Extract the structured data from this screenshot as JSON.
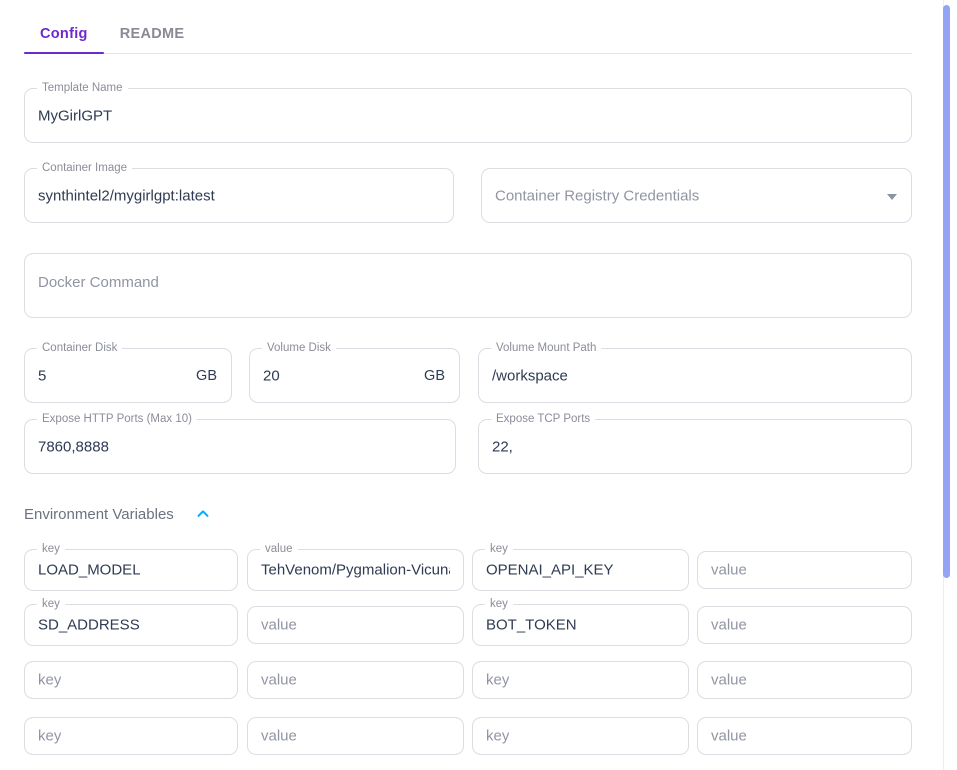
{
  "tabs": [
    {
      "label": "Config",
      "active": true
    },
    {
      "label": "README",
      "active": false
    }
  ],
  "colors": {
    "accent_purple": "#6b29cf",
    "chevron_cyan": "#00b0ff",
    "scrollbar_thumb": "#93a3f5",
    "value_text": "#2f3b52",
    "label_text": "#8b8d98"
  },
  "form": {
    "template_name": {
      "label": "Template Name",
      "value": "MyGirlGPT"
    },
    "container_image": {
      "label": "Container Image",
      "value": "synthintel2/mygirlgpt:latest"
    },
    "registry_credentials": {
      "placeholder": "Container Registry Credentials",
      "value": ""
    },
    "docker_command": {
      "placeholder": "Docker Command",
      "value": ""
    },
    "container_disk": {
      "label": "Container Disk",
      "value": "5",
      "unit": "GB"
    },
    "volume_disk": {
      "label": "Volume Disk",
      "value": "20",
      "unit": "GB"
    },
    "volume_mount_path": {
      "label": "Volume Mount Path",
      "value": "/workspace"
    },
    "http_ports": {
      "label": "Expose HTTP Ports (Max 10)",
      "value": "7860,8888"
    },
    "tcp_ports": {
      "label": "Expose TCP Ports",
      "value": "22,"
    }
  },
  "env_section": {
    "title": "Environment Variables",
    "collapse_icon": "chevron-up-icon",
    "key_label": "key",
    "value_label": "value",
    "key_placeholder": "key",
    "value_placeholder": "value",
    "rows": [
      {
        "left_key": "LOAD_MODEL",
        "left_value": "TehVenom/Pygmalion-Vicuna",
        "right_key": "OPENAI_API_KEY",
        "right_value": ""
      },
      {
        "left_key": "SD_ADDRESS",
        "left_value": "",
        "right_key": "BOT_TOKEN",
        "right_value": ""
      },
      {
        "left_key": "",
        "left_value": "",
        "right_key": "",
        "right_value": ""
      },
      {
        "left_key": "",
        "left_value": "",
        "right_key": "",
        "right_value": ""
      }
    ]
  }
}
